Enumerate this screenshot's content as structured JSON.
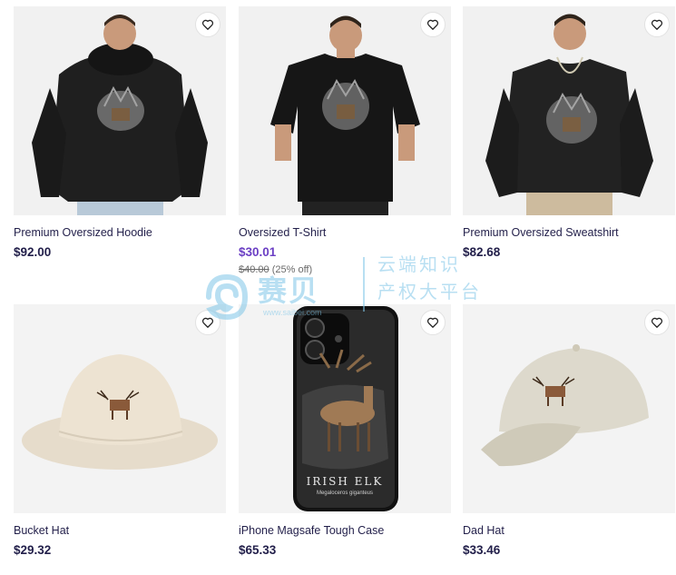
{
  "products": [
    {
      "title": "Premium Oversized Hoodie",
      "price": "$92.00"
    },
    {
      "title": "Oversized T-Shirt",
      "price": "$30.01",
      "original_price": "$40.00",
      "discount": "(25% off)"
    },
    {
      "title": "Premium Oversized Sweatshirt",
      "price": "$82.68"
    },
    {
      "title": "Bucket Hat",
      "price": "$29.32"
    },
    {
      "title": "iPhone Magsafe Tough Case",
      "price": "$65.33",
      "case_text": "IRISH ELK",
      "case_subtext": "Megaloceros giganteus"
    },
    {
      "title": "Dad Hat",
      "price": "$33.46"
    }
  ],
  "watermark": {
    "logo_text": "赛贝",
    "line1": "云端知识",
    "line2": "产权大平台",
    "url": "www.saibei.com"
  },
  "colors": {
    "text": "#221f4a",
    "sale": "#6b3fc4",
    "background": "#f2f2f2"
  }
}
